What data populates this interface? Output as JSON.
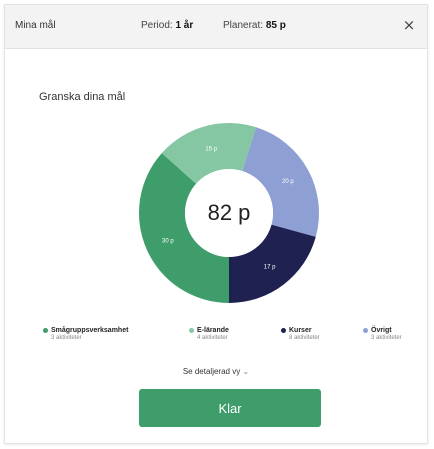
{
  "header": {
    "title": "Mina mål",
    "period_label": "Period:",
    "period_value": "1 år",
    "planned_label": "Planerat:",
    "planned_value": "85 p",
    "close_icon": "close-icon",
    "close_glyph": "×"
  },
  "main": {
    "heading": "Granska dina mål",
    "total_label": "82 p",
    "details_link": "Se detaljerad vy",
    "details_chevron": "⌄",
    "done_button": "Klar"
  },
  "chart_data": {
    "type": "pie",
    "center_text": "82 p",
    "slices": [
      {
        "name": "Smågruppsverksamhet",
        "value": 30,
        "label": "30 p",
        "color": "#3e9d6b"
      },
      {
        "name": "E-lärande",
        "value": 15,
        "label": "15 p",
        "color": "#86c7a3"
      },
      {
        "name": "Övrigt",
        "value": 20,
        "label": "20 p",
        "color": "#8d9fd3"
      },
      {
        "name": "Kurser",
        "value": 17,
        "label": "17 p",
        "color": "#1f2251"
      }
    ]
  },
  "legend": [
    {
      "label": "Smågruppsverksamhet",
      "sub": "3 aktiviteter",
      "color": "#3e9d6b"
    },
    {
      "label": "E-lärande",
      "sub": "4 aktiviteter",
      "color": "#86c7a3"
    },
    {
      "label": "Kurser",
      "sub": "8 aktiviteter",
      "color": "#1f2251"
    },
    {
      "label": "Övrigt",
      "sub": "3 aktiviteter",
      "color": "#8d9fd3"
    }
  ]
}
